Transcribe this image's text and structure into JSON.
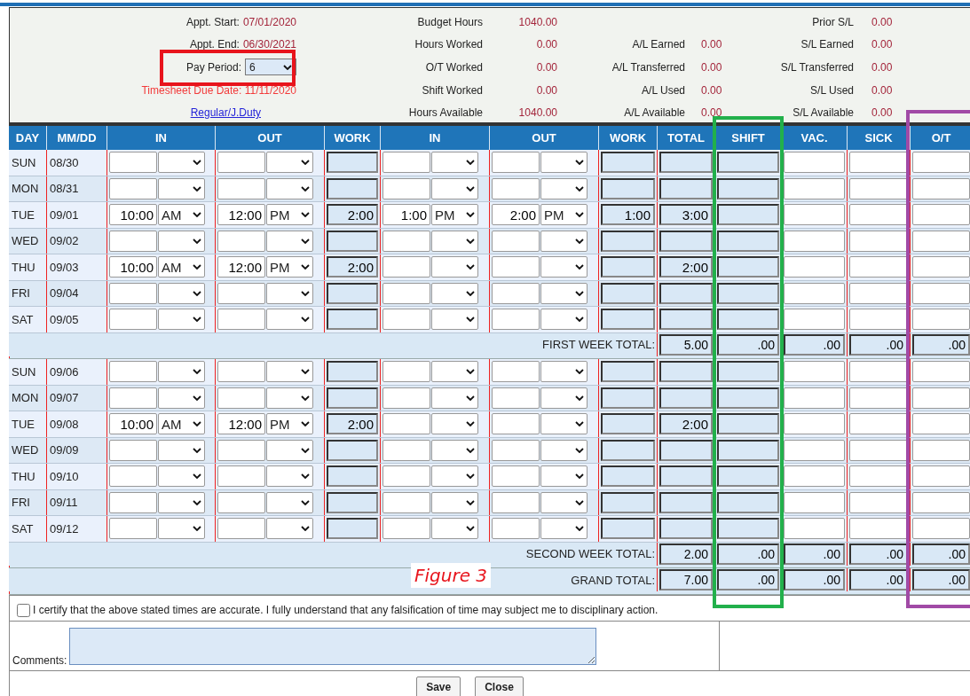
{
  "summary": {
    "left": [
      {
        "kind": "field",
        "label": "Appt. Start:",
        "value": "07/01/2020"
      },
      {
        "kind": "field",
        "label": "Appt. End:",
        "value": "06/30/2021"
      },
      {
        "kind": "select",
        "label": "Pay Period:",
        "value": "6"
      },
      {
        "kind": "notice",
        "text": "Timesheet Due Date: 11/11/2020"
      },
      {
        "kind": "link",
        "text": "Regular/J.Duty"
      }
    ],
    "hours": [
      {
        "label": "Budget Hours",
        "value": "1040.00"
      },
      {
        "label": "Hours Worked",
        "value": "0.00"
      },
      {
        "label": "O/T Worked",
        "value": "0.00"
      },
      {
        "label": "Shift Worked",
        "value": "0.00"
      },
      {
        "label": "Hours Available",
        "value": "1040.00"
      }
    ],
    "annual_leave": [
      {
        "label": "A/L Earned",
        "value": "0.00"
      },
      {
        "label": "A/L Transferred",
        "value": "0.00"
      },
      {
        "label": "A/L Used",
        "value": "0.00"
      },
      {
        "label": "A/L Available",
        "value": "0.00"
      }
    ],
    "sick_leave": [
      {
        "label": "Prior S/L",
        "value": "0.00"
      },
      {
        "label": "S/L Earned",
        "value": "0.00"
      },
      {
        "label": "S/L Transferred",
        "value": "0.00"
      },
      {
        "label": "S/L Used",
        "value": "0.00"
      },
      {
        "label": "S/L Available",
        "value": "0.00"
      }
    ]
  },
  "columns": [
    "DAY",
    "MM/DD",
    "IN",
    "OUT",
    "WORK",
    "IN",
    "OUT",
    "WORK",
    "TOTAL",
    "SHIFT",
    "VAC.",
    "SICK",
    "O/T"
  ],
  "weeks": [
    {
      "days": [
        {
          "day": "SUN",
          "date": "08/30"
        },
        {
          "day": "MON",
          "date": "08/31"
        },
        {
          "day": "TUE",
          "date": "09/01",
          "in_1": {
            "time": "10:00",
            "period": "AM"
          },
          "out_1": {
            "time": "12:00",
            "period": "PM"
          },
          "work_1": "2:00",
          "in_2": {
            "time": "1:00",
            "period": "PM"
          },
          "out_2": {
            "time": "2:00",
            "period": "PM"
          },
          "work_2": "1:00",
          "total": "3:00"
        },
        {
          "day": "WED",
          "date": "09/02"
        },
        {
          "day": "THU",
          "date": "09/03",
          "in_1": {
            "time": "10:00",
            "period": "AM"
          },
          "out_1": {
            "time": "12:00",
            "period": "PM"
          },
          "work_1": "2:00",
          "total": "2:00"
        },
        {
          "day": "FRI",
          "date": "09/04"
        },
        {
          "day": "SAT",
          "date": "09/05"
        }
      ],
      "total": {
        "label": "FIRST WEEK TOTAL:",
        "values": [
          "5.00",
          ".00",
          ".00",
          ".00",
          ".00"
        ]
      }
    },
    {
      "days": [
        {
          "day": "SUN",
          "date": "09/06"
        },
        {
          "day": "MON",
          "date": "09/07"
        },
        {
          "day": "TUE",
          "date": "09/08",
          "in_1": {
            "time": "10:00",
            "period": "AM"
          },
          "out_1": {
            "time": "12:00",
            "period": "PM"
          },
          "work_1": "2:00",
          "total": "2:00"
        },
        {
          "day": "WED",
          "date": "09/09"
        },
        {
          "day": "THU",
          "date": "09/10"
        },
        {
          "day": "FRI",
          "date": "09/11"
        },
        {
          "day": "SAT",
          "date": "09/12"
        }
      ],
      "total": {
        "label": "SECOND WEEK TOTAL:",
        "values": [
          "2.00",
          ".00",
          ".00",
          ".00",
          ".00"
        ]
      }
    }
  ],
  "grand_total": {
    "label": "GRAND TOTAL:",
    "values": [
      "7.00",
      ".00",
      ".00",
      ".00",
      ".00"
    ]
  },
  "certify": {
    "checked": false,
    "text": "I certify that the above stated times are accurate. I fully understand that any falsification of time may subject me to disciplinary action."
  },
  "comments": {
    "label": "Comments:"
  },
  "buttons": [
    "Save",
    "Close"
  ],
  "annotations": {
    "figure_label": "Figure 3",
    "highlights": [
      {
        "color": "#e8141c"
      },
      {
        "color": "#22b04b"
      },
      {
        "color": "#a14aa6"
      }
    ]
  }
}
